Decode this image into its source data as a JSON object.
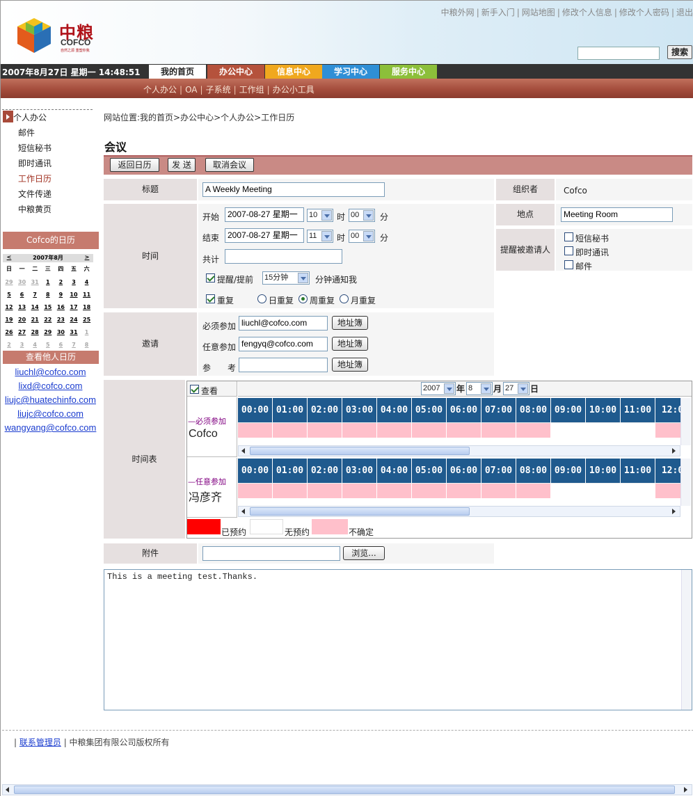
{
  "header": {
    "logo_cn": "中粮",
    "logo_en": "COFCO",
    "logo_sub": "自然之源 重塑你我",
    "top_links": [
      "中粮外网",
      "新手入门",
      "网站地图",
      "修改个人信息",
      "修改个人密码",
      "退出"
    ],
    "search_button": "搜索",
    "search_value": ""
  },
  "nav": {
    "datetime": "2007年8月27日 星期一 14:48:51",
    "tabs": [
      {
        "label": "我的首页",
        "color": "#ffffff",
        "text": "#222222"
      },
      {
        "label": "办公中心",
        "color": "#b5523c",
        "text": "#ffffff"
      },
      {
        "label": "信息中心",
        "color": "#f0a81e",
        "text": "#ffffff"
      },
      {
        "label": "学习中心",
        "color": "#2f8fd6",
        "text": "#ffffff"
      },
      {
        "label": "服务中心",
        "color": "#8cbf3a",
        "text": "#ffffff"
      }
    ]
  },
  "subnav": {
    "items": [
      "个人办公",
      "OA",
      "子系统",
      "工作组",
      "办公小工具"
    ]
  },
  "sidebar": {
    "section": "个人办公",
    "items": [
      "邮件",
      "短信秘书",
      "即时通讯",
      "工作日历",
      "文件传递",
      "中粮黄页"
    ],
    "active": "工作日历",
    "calendar_title": "Cofco的日历",
    "calendar_month": "2007年8月",
    "prev": "<",
    "next": ">",
    "weekdays": [
      "日",
      "一",
      "二",
      "三",
      "四",
      "五",
      "六"
    ],
    "weeks": [
      [
        "29",
        "30",
        "31",
        "1",
        "2",
        "3",
        "4"
      ],
      [
        "5",
        "6",
        "7",
        "8",
        "9",
        "10",
        "11"
      ],
      [
        "12",
        "13",
        "14",
        "15",
        "16",
        "17",
        "18"
      ],
      [
        "19",
        "20",
        "21",
        "22",
        "23",
        "24",
        "25"
      ],
      [
        "26",
        "27",
        "28",
        "29",
        "30",
        "31",
        "1"
      ],
      [
        "2",
        "3",
        "4",
        "5",
        "6",
        "7",
        "8"
      ]
    ],
    "other_title": "查看他人日历",
    "others": [
      "liuchl@cofco.com",
      "lixd@cofco.com",
      "liujc@huatechinfo.com",
      "liujc@cofco.com",
      "wangyang@cofco.com"
    ]
  },
  "breadcrumb": "网站位置:我的首页>办公中心>个人办公>工作日历",
  "page_title": "会议",
  "toolbar": {
    "back": "返回日历",
    "send": "发 送",
    "cancel": "取消会议"
  },
  "form": {
    "subject_label": "标题",
    "subject": "A Weekly Meeting",
    "organizer_label": "组织者",
    "organizer": "Cofco",
    "location_label": "地点",
    "location": "Meeting Room",
    "remind_invitees_label": "提醒被邀请人",
    "remind_options": [
      "短信秘书",
      "即时通讯",
      "邮件"
    ],
    "time_label": "时间",
    "start_label": "开始",
    "start_date": "2007-08-27 星期一",
    "start_hour": "10",
    "start_min": "00",
    "end_label": "结束",
    "end_date": "2007-08-27 星期一",
    "end_hour": "11",
    "end_min": "00",
    "hour_unit": "时",
    "min_unit": "分",
    "total_label": "共计",
    "total": "",
    "remind_label": "提醒/提前",
    "remind_value": "15分钟",
    "remind_suffix": "分钟通知我",
    "repeat_label": "重复",
    "repeat_options": [
      "日重复",
      "周重复",
      "月重复"
    ],
    "repeat_selected": "周重复",
    "invite_label": "邀请",
    "required_label": "必须参加",
    "required": "liuchl@cofco.com",
    "optional_label": "任意参加",
    "optional": "fengyq@cofco.com",
    "ref_label": "参　　考",
    "ref": "",
    "addr_button": "地址簿"
  },
  "schedule": {
    "label": "时间表",
    "view_label": "查看",
    "year": "2007",
    "year_unit": "年",
    "month": "8",
    "month_unit": "月",
    "day": "27",
    "day_unit": "日",
    "hours": [
      "00:00",
      "01:00",
      "02:00",
      "03:00",
      "04:00",
      "05:00",
      "06:00",
      "07:00",
      "08:00",
      "09:00",
      "10:00",
      "11:00",
      "12:0"
    ],
    "rows": [
      {
        "role": "—必须参加",
        "name": "Cofco",
        "status": [
          "u",
          "u",
          "u",
          "u",
          "u",
          "u",
          "u",
          "u",
          "u",
          "f",
          "f",
          "f",
          "u"
        ]
      },
      {
        "role": "—任意参加",
        "name": "冯彦齐",
        "status": [
          "u",
          "u",
          "u",
          "u",
          "u",
          "u",
          "u",
          "u",
          "u",
          "f",
          "f",
          "f",
          "u"
        ]
      }
    ],
    "colors": {
      "booked": "#ff0000",
      "free": "#ffffff",
      "uncertain": "#ffc0cb",
      "header": "#1f5a8e",
      "role": "#800080"
    },
    "legend": [
      "已预约",
      "无预约",
      "不确定"
    ]
  },
  "attachment": {
    "label": "附件",
    "browse": "浏览...",
    "value": ""
  },
  "notes": "This is a meeting test.Thanks.",
  "footer": {
    "admin_link": "联系管理员",
    "copyright": "中粮集团有限公司版权所有"
  }
}
